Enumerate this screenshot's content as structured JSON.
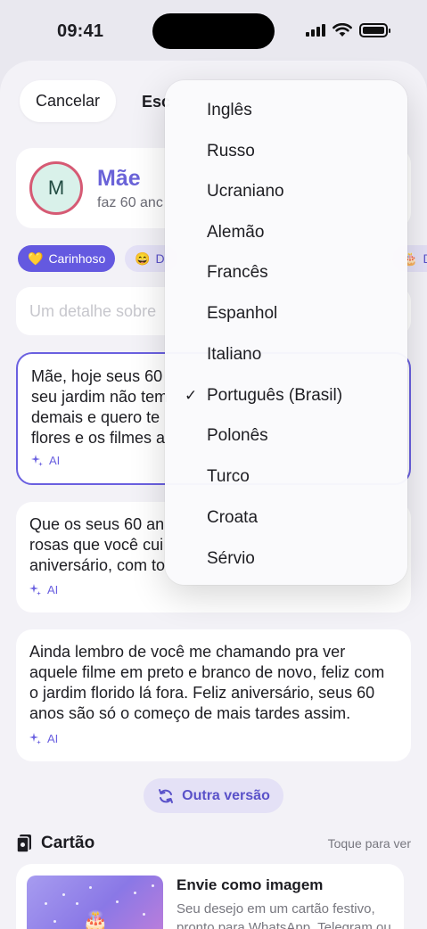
{
  "status_bar": {
    "time": "09:41",
    "icons": [
      "cellular-signal-icon",
      "wifi-icon",
      "battery-icon"
    ],
    "battery_level": 1.0
  },
  "header": {
    "cancel_label": "Cancelar",
    "title_visible": "Esc"
  },
  "recipient": {
    "initial": "M",
    "name": "Mãe",
    "subtitle_visible": "faz 60 anc"
  },
  "tones": [
    {
      "icon": "💛",
      "label": "Carinhoso",
      "active": true
    },
    {
      "icon": "😄",
      "label": "Di",
      "active": false
    },
    {
      "icon": "🎂",
      "label": "D",
      "active": false
    }
  ],
  "detail_input": {
    "placeholder_visible": "Um detalhe sobre"
  },
  "wishes": [
    {
      "lines": [
        "Mãe, hoje seus 60",
        "seu jardim não tem",
        "demais e quero te",
        "flores e os filmes a"
      ],
      "tag": "AI",
      "selected": true
    },
    {
      "lines": [
        "Que os seus 60 an",
        "rosas que você cui",
        "aniversário, com to"
      ],
      "tag": "AI",
      "selected": false
    },
    {
      "lines": [
        "Ainda lembro de você me chamando pra ver",
        "aquele filme em preto e branco de novo, feliz com",
        "o jardim florido lá fora. Feliz aniversário, seus 60",
        "anos são só o começo de mais tardes assim."
      ],
      "tag": "AI",
      "selected": false
    }
  ],
  "other_version_label": "Outra versão",
  "card_section": {
    "title": "Cartão",
    "hint": "Toque para ver",
    "image_title": "Envie como imagem",
    "image_desc": "Seu desejo em um cartão festivo, pronto para WhatsApp, Telegram ou"
  },
  "language_menu": {
    "selected": "Português (Brasil)",
    "items": [
      "Inglês",
      "Russo",
      "Ucraniano",
      "Alemão",
      "Francês",
      "Espanhol",
      "Italiano",
      "Português (Brasil)",
      "Polonês",
      "Turco",
      "Croata",
      "Sérvio"
    ]
  },
  "colors": {
    "accent": "#6459e0",
    "accent_soft": "#e4e1f6",
    "avatar_ring": "#d65a74",
    "avatar_bg": "#d9f1ea"
  }
}
